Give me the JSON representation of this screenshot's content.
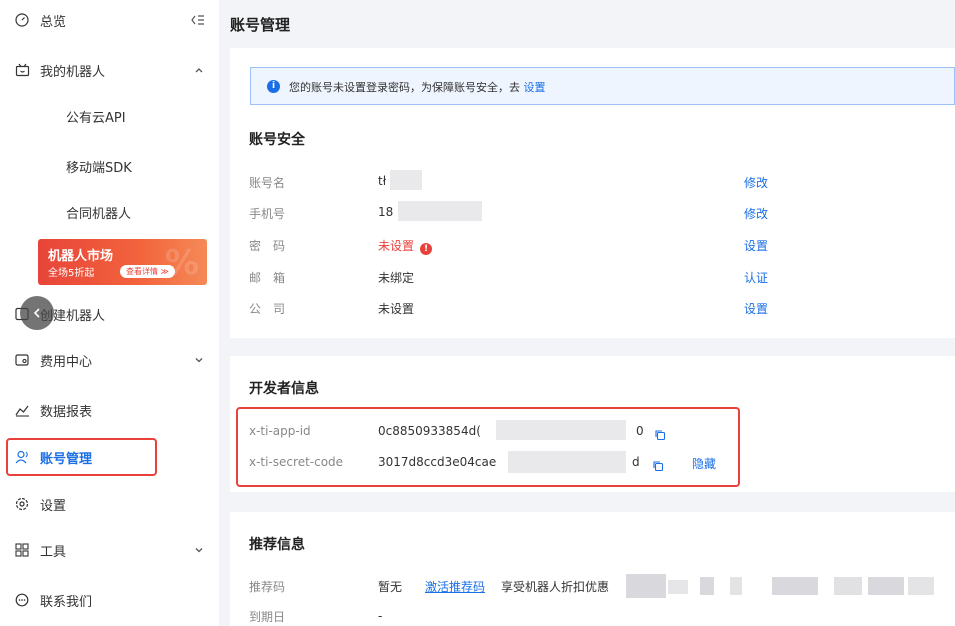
{
  "sidebar": {
    "overview": "总览",
    "my_robots": "我的机器人",
    "public_api": "公有云API",
    "mobile_sdk": "移动端SDK",
    "contract_robot": "合同机器人",
    "promo": {
      "title": "机器人市场",
      "subtitle": "全场5折起",
      "pill": "查看详情 ≫"
    },
    "create_robot": "创建机器人",
    "billing": "费用中心",
    "reports": "数据报表",
    "account": "账号管理",
    "settings": "设置",
    "tools": "工具",
    "contact": "联系我们"
  },
  "page": {
    "title": "账号管理"
  },
  "notice": {
    "text": "您的账号未设置登录密码，为保障账号安全，去",
    "link": "设置"
  },
  "security": {
    "title": "账号安全",
    "rows": [
      {
        "label": "账号名",
        "value": "tł",
        "action": "修改"
      },
      {
        "label": "手机号",
        "value": "18",
        "action": "修改"
      },
      {
        "label": "密　码",
        "value": "未设置",
        "action": "设置"
      },
      {
        "label": "邮　箱",
        "value": "未绑定",
        "action": "认证"
      },
      {
        "label": "公　司",
        "value": "未设置",
        "action": "设置"
      }
    ]
  },
  "developer": {
    "title": "开发者信息",
    "app_id_label": "x-ti-app-id",
    "app_id_value_start": "0c8850933854d(",
    "app_id_value_end": "0",
    "secret_label": "x-ti-secret-code",
    "secret_value_start": "3017d8ccd3e04cae",
    "secret_value_end": "d",
    "hide_action": "隐藏"
  },
  "referral": {
    "title": "推荐信息",
    "code_label": "推荐码",
    "code_value": "暂无",
    "activate_link": "激活推荐码",
    "benefit_text": "享受机器人折扣优惠",
    "expiry_label": "到期日",
    "expiry_value": "-"
  },
  "colors": {
    "accent": "#1a6fe6",
    "danger": "#e8413b",
    "promo": "#f2633c"
  }
}
